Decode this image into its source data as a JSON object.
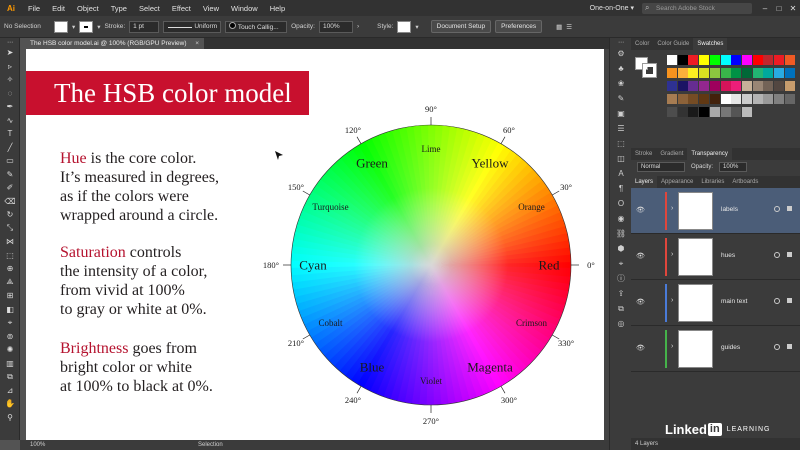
{
  "menubar": {
    "logo": "Ai",
    "items": [
      "File",
      "Edit",
      "Object",
      "Type",
      "Select",
      "Effect",
      "View",
      "Window",
      "Help"
    ],
    "workspace": "One-on-One ▾",
    "search_placeholder": "Search Adobe Stock",
    "window_buttons": [
      "–",
      "□",
      "✕"
    ]
  },
  "controlbar": {
    "selection_label": "No Selection",
    "stroke_label": "Stroke:",
    "stroke_weight": "1 pt",
    "profile": "Uniform",
    "brush": "Touch Callig...",
    "opacity_label": "Opacity:",
    "opacity_value": "100%",
    "style_label": "Style:",
    "document_setup": "Document Setup",
    "preferences": "Preferences"
  },
  "document": {
    "tab_title": "The HSB color model.ai @ 100% (RGB/GPU Preview)",
    "close": "×"
  },
  "slide": {
    "title": "The HSB color model",
    "hue": {
      "term": "Hue",
      "lines": [
        " is the core color.",
        "It’s measured in degrees,",
        "as if the colors were",
        "wrapped around a circle."
      ]
    },
    "saturation": {
      "term": "Saturation",
      "lines": [
        " controls",
        "the intensity of a color,",
        "from vivid at 100%",
        "to gray or white at 0%."
      ]
    },
    "brightness": {
      "term": "Brightness",
      "lines": [
        " goes from",
        "bright color or white",
        "at 100% to black at 0%."
      ]
    }
  },
  "wheel": {
    "major_labels": [
      {
        "text": "Red",
        "angle": 0
      },
      {
        "text": "Yellow",
        "angle": 60
      },
      {
        "text": "Green",
        "angle": 120
      },
      {
        "text": "Cyan",
        "angle": 180
      },
      {
        "text": "Blue",
        "angle": 240
      },
      {
        "text": "Magenta",
        "angle": 300
      }
    ],
    "minor_labels": [
      {
        "text": "Orange",
        "angle": 30
      },
      {
        "text": "Lime",
        "angle": 90
      },
      {
        "text": "Turquoise",
        "angle": 150
      },
      {
        "text": "Cobalt",
        "angle": 210
      },
      {
        "text": "Violet",
        "angle": 270
      },
      {
        "text": "Crimson",
        "angle": 330
      }
    ],
    "degree_labels": [
      {
        "text": "0°",
        "angle": 0
      },
      {
        "text": "30°",
        "angle": 30
      },
      {
        "text": "60°",
        "angle": 60
      },
      {
        "text": "90°",
        "angle": 90
      },
      {
        "text": "120°",
        "angle": 120
      },
      {
        "text": "150°",
        "angle": 150
      },
      {
        "text": "180°",
        "angle": 180
      },
      {
        "text": "210°",
        "angle": 210
      },
      {
        "text": "240°",
        "angle": 240
      },
      {
        "text": "270°",
        "angle": 270
      },
      {
        "text": "300°",
        "angle": 300
      },
      {
        "text": "330°",
        "angle": 330
      }
    ]
  },
  "statusbar": {
    "zoom": "100%",
    "mode": "Selection"
  },
  "panels": {
    "swatch_tabs": [
      "Color",
      "Color Guide",
      "Swatches"
    ],
    "stroke_tabs": [
      "Stroke",
      "Gradient",
      "Transparency"
    ],
    "blend_mode": "Normal",
    "opacity_label": "Opacity:",
    "opacity_value": "100%",
    "layer_tabs": [
      "Layers",
      "Appearance",
      "Libraries",
      "Artboards"
    ],
    "layers": [
      {
        "name": "labels",
        "color": "#e0463c",
        "selected": true
      },
      {
        "name": "hues",
        "color": "#e0463c",
        "selected": false
      },
      {
        "name": "main text",
        "color": "#4a7bd8",
        "selected": false
      },
      {
        "name": "guides",
        "color": "#45b24a",
        "selected": false
      }
    ],
    "layers_count": "4 Layers"
  },
  "brand": {
    "name": "Linked",
    "badge": "in",
    "suffix": "LEARNING"
  },
  "swatches": [
    "#ffffff",
    "#000000",
    "#ed1c24",
    "#ffff00",
    "#00ff00",
    "#00ffff",
    "#0000ff",
    "#ff00ff",
    "#ff0000",
    "#c1272d",
    "#ed1c24",
    "#f15a24",
    "#f7931e",
    "#fbb03b",
    "#fcee21",
    "#d9e021",
    "#8cc63f",
    "#39b54a",
    "#009245",
    "#006837",
    "#22b573",
    "#00a99d",
    "#29abe2",
    "#0071bc",
    "#2e3192",
    "#1b1464",
    "#662d91",
    "#93278f",
    "#9e005d",
    "#d4145a",
    "#ed1e79",
    "#c7b299",
    "#998675",
    "#736357",
    "#534741",
    "#c69c6d",
    "#a67c52",
    "#8c6239",
    "#754c24",
    "#603813",
    "#42210b",
    "#ffffff",
    "#e6e6e6",
    "#cccccc",
    "#b3b3b3",
    "#999999",
    "#808080",
    "#666666",
    "#4d4d4d",
    "#333333",
    "#1a1a1a",
    "#000000",
    "#aaaaaa",
    "#777777",
    "#555555",
    "#bbbbbb"
  ]
}
